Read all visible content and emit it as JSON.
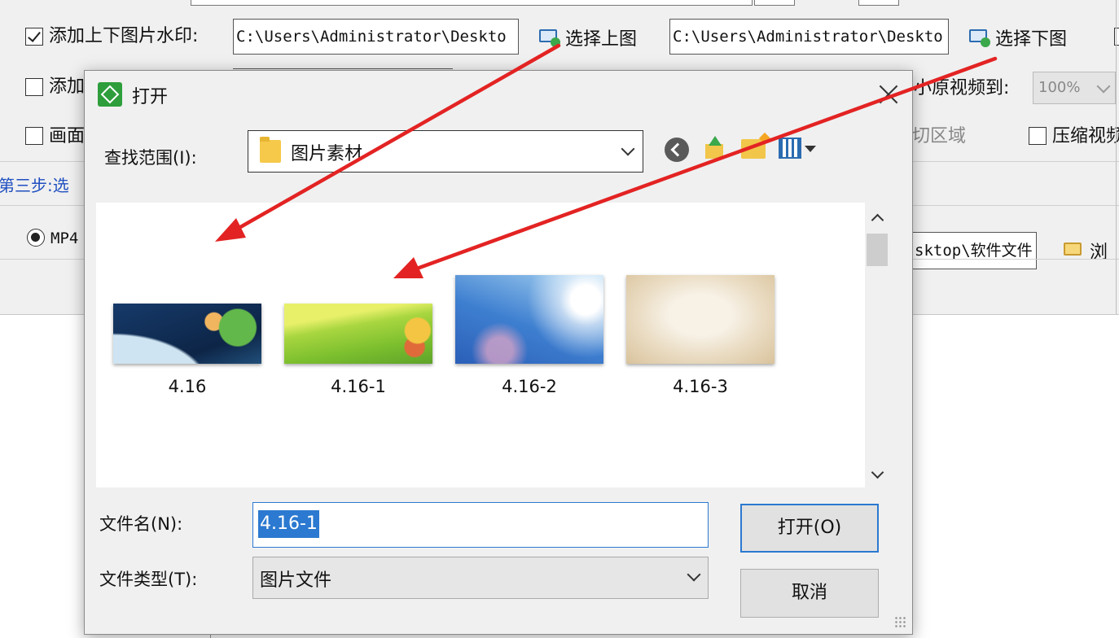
{
  "background_app": {
    "row1": {
      "checkbox_label": "添加上下图片水印:",
      "top_path": "C:\\Users\\Administrator\\Deskto",
      "select_top_button": "选择上图",
      "bottom_path": "C:\\Users\\Administrator\\Deskto",
      "select_bottom_button": "选择下图"
    },
    "row2": {
      "checkbox_label_partial": "添加",
      "shrink_label_partial": "小原视频到:",
      "shrink_value": "100%"
    },
    "row3": {
      "checkbox_label_partial": "画面",
      "crop_label_partial": "切区域",
      "compress_label_partial": "压缩视频"
    },
    "step3_label_partial": "第三步:选",
    "format_radio_label": "MP4",
    "output_path_partial": "sktop\\软件文件",
    "browse_button_partial": "浏"
  },
  "dialog": {
    "title": "打开",
    "look_in_label": "查找范围(I):",
    "look_in_value": "图片素材",
    "files": [
      {
        "name": "4.16",
        "thumb": "night-earth-girl"
      },
      {
        "name": "4.16-1",
        "thumb": "green-hill-girl"
      },
      {
        "name": "4.16-2",
        "thumb": "blue-sky-sun"
      },
      {
        "name": "4.16-3",
        "thumb": "beige-frame"
      }
    ],
    "filename_label": "文件名(N):",
    "filename_value": "4.16-1",
    "filetype_label": "文件类型(T):",
    "filetype_value": "图片文件",
    "open_button": "打开(O)",
    "cancel_button": "取消"
  },
  "colors": {
    "annotation_arrow": "#e32323",
    "selection": "#2b79d0",
    "app_bg": "#f0f0f0"
  }
}
